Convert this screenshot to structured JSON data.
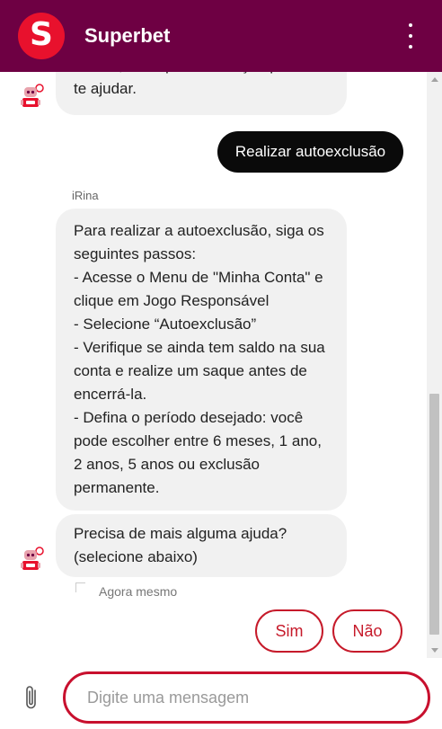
{
  "header": {
    "logo_letter": "S",
    "title": "Superbet",
    "menu_icon": "more-vertical-icon",
    "bg_color": "#6e0043"
  },
  "messages": {
    "bot_1": "abaixo, com que informação posso\nte ajudar.",
    "user_1": "Realizar autoexclusão",
    "sender_name": "iRina",
    "bot_2": "Para realizar a autoexclusão, siga os seguintes passos:\n- Acesse o Menu de \"Minha Conta\" e clique em Jogo Responsável\n- Selecione “Autoexclusão”\n- Verifique se ainda tem saldo na sua conta e realize um saque antes de encerrá-la.\n- Defina o período desejado: você pode escolher entre 6 meses, 1 ano, 2 anos, 5 anos ou exclusão permanente.",
    "bot_3": "Precisa de mais alguma ajuda?\n(selecione abaixo)",
    "timestamp": "Agora mesmo"
  },
  "quick_replies": {
    "yes": "Sim",
    "no": "Não"
  },
  "composer": {
    "placeholder": "Digite uma mensagem",
    "value": "",
    "attach_icon": "paperclip-icon"
  },
  "colors": {
    "accent": "#c8102e",
    "brand_red": "#e8112d",
    "user_bubble": "#0a0a0a",
    "bot_bubble": "#f1f1f1"
  }
}
